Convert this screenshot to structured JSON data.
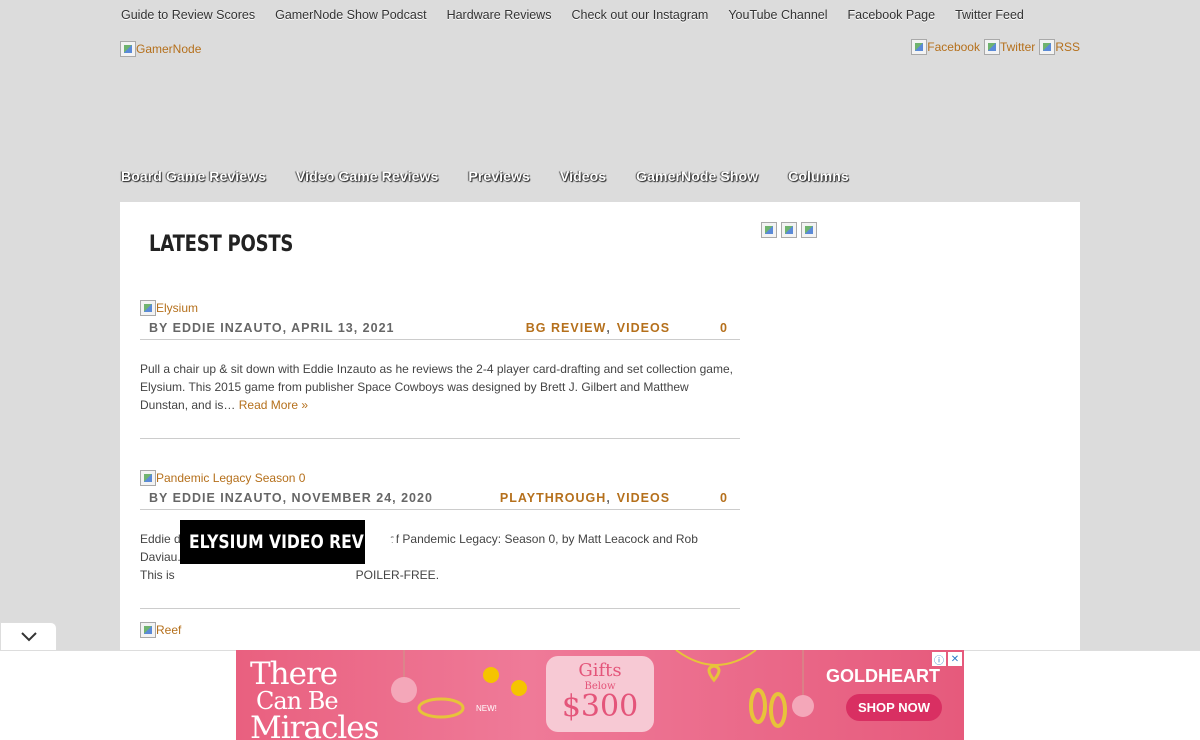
{
  "top_nav": [
    "Guide to Review Scores",
    "GamerNode Show Podcast",
    "Hardware Reviews",
    "Check out our Instagram",
    "YouTube Channel",
    "Facebook Page",
    "Twitter Feed"
  ],
  "logo_alt": "GamerNode",
  "social": {
    "facebook": "Facebook",
    "twitter": "Twitter",
    "rss": "RSS"
  },
  "main_nav": [
    "Board Game Reviews",
    "Video Game Reviews",
    "Previews",
    "Videos",
    "GamerNode Show",
    "Columns"
  ],
  "section_title": "LATEST POSTS",
  "posts": [
    {
      "thumb_alt": "Elysium",
      "byline": "BY EDDIE INZAUTO, APRIL 13, 2021",
      "cat1": "BG REVIEW",
      "cat2": "VIDEOS",
      "comments": "0",
      "excerpt": "Pull a chair up & sit down with Eddie Inzauto as he reviews the 2-4 player card-drafting and set collection game, Elysium. This 2015 game from publisher Space Cowboys was designed by Brett J. Gilbert and Matthew Dunstan, and is…",
      "read_more": "Read More »"
    },
    {
      "thumb_alt": "Pandemic Legacy Season 0",
      "byline": "BY EDDIE INZAUTO, NOVEMBER 24, 2020",
      "cat1": "PLAYTHROUGH",
      "cat2": "VIDEOS",
      "comments": "0",
      "excerpt_a": "Eddie d",
      "excerpt_b": "of Pandemic Legacy: Season 0, by Matt Leacock and Rob Daviau.",
      "excerpt_c": "This is",
      "excerpt_d": "POILER-FREE."
    },
    {
      "thumb_alt": "Reef"
    }
  ],
  "tooltip": "ELYSIUM VIDEO REVIEW",
  "ad": {
    "headline_1": "There",
    "headline_2": "Can Be",
    "headline_3": "Miracles",
    "gifts_1": "Gifts",
    "gifts_2": "Below",
    "gifts_3": "$300",
    "new": "NEW!",
    "brand": "GOLDHEART",
    "shop": "SHOP NOW",
    "info": "ⓘ",
    "close": "✕"
  }
}
